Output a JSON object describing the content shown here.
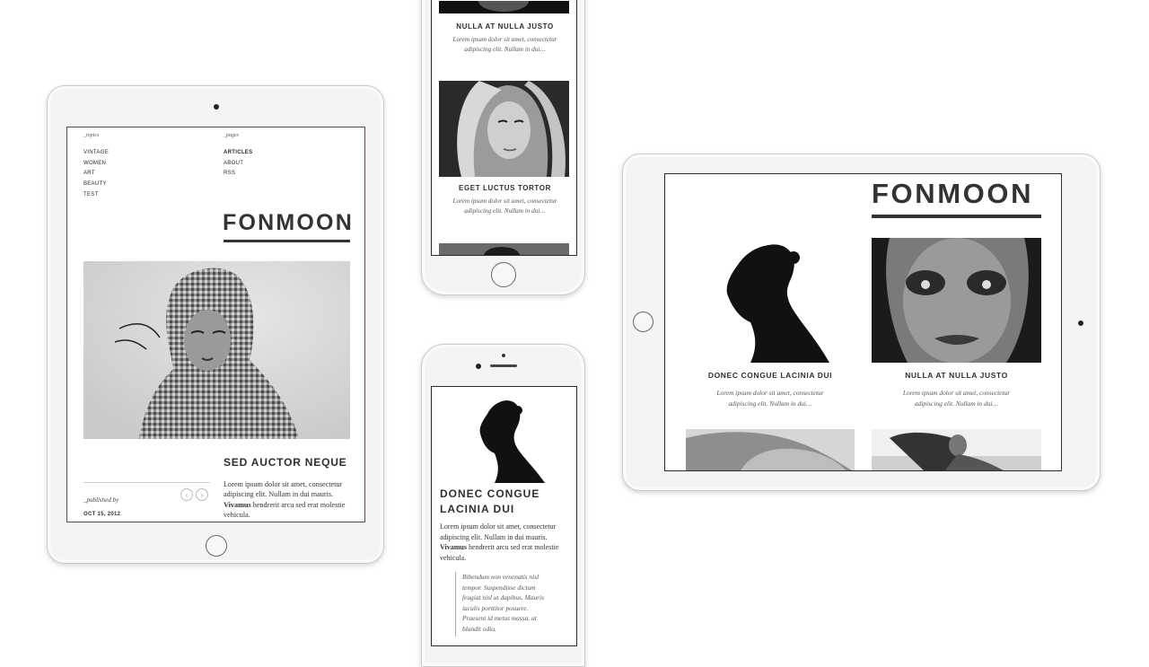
{
  "brand": "FONMOON",
  "ipad_portrait": {
    "topics_heading": "_topics",
    "pages_heading": "_pages",
    "topics": [
      "VINTAGE",
      "WOMEN",
      "ART",
      "BEAUTY",
      "TEST"
    ],
    "pages": [
      "ARTICLES",
      "ABOUT",
      "RSS"
    ],
    "article_title": "SED AUCTOR NEQUE",
    "published_by": "_published by",
    "date": "OCT 15, 2012",
    "body_1": "Lorem ipsum dolor sit amet, consectetur adipiscing elit. Nullam in dui mauris.",
    "body_bold": "Vivamus",
    "body_2": "hendrerit arcu sed erat molestie vehicula."
  },
  "iphone_top": {
    "card1_title": "NULLA AT NULLA JUSTO",
    "card1_text": "Lorem ipsum dolor sit amet, consectetur adipiscing elit. Nullam in dui…",
    "card2_title": "EGET LUCTUS TORTOR",
    "card2_text": "Lorem ipsum dolor sit amet, consectetur adipiscing elit. Nullam in dui…"
  },
  "iphone_bottom": {
    "title": "DONEC CONGUE LACINIA DUI",
    "body_1": "Lorem ipsum dolor sit amet, consectetur adipiscing elit. Nullam in dui mauris.",
    "body_bold": "Vivamus",
    "body_2": "hendrerit arcu sed erat molestie vehicula.",
    "quote": "Bibendum non venenatis nisl tempor. Suspendisse dictum feugiat nisl ut dapibus. Mauris iaculis porttitor posuere. Praesent id metus massa, ut blandit odio."
  },
  "ipad_landscape": {
    "card1_title": "DONEC CONGUE LACINIA DUI",
    "card1_text": "Lorem ipsum dolor sit amet, consectetur adipiscing elit. Nullam in dui…",
    "card2_title": "NULLA AT NULLA JUSTO",
    "card2_text": "Lorem ipsum dolor sit amet, consectetur adipiscing elit. Nullam in dui…"
  },
  "colors": {
    "accent": "#333333",
    "frame": "#2b2b2b",
    "device": "#f3f4f6"
  }
}
